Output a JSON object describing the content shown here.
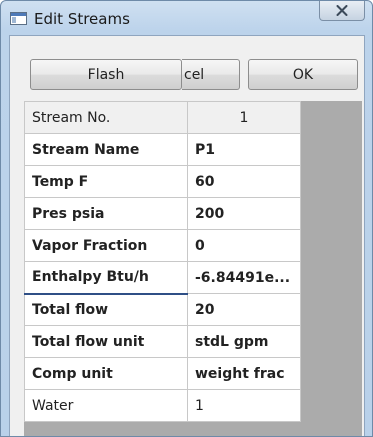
{
  "window": {
    "title": "Edit Streams"
  },
  "icons": {
    "app": "window-app-icon",
    "close": "close-icon"
  },
  "buttons": {
    "flash": "Flash",
    "cancel": "cel",
    "ok": "OK"
  },
  "grid": {
    "rows": [
      {
        "label": "Stream No.",
        "value": "1"
      },
      {
        "label": "Stream Name",
        "value": "P1"
      },
      {
        "label": "Temp  F",
        "value": "60"
      },
      {
        "label": "Pres  psia",
        "value": "200"
      },
      {
        "label": "Vapor Fraction",
        "value": "0"
      },
      {
        "label": "Enthalpy Btu/h",
        "value": "-6.84491e..."
      },
      {
        "label": "Total flow",
        "value": "20"
      },
      {
        "label": "Total flow unit",
        "value": "stdL gpm"
      },
      {
        "label": "Comp unit",
        "value": "weight frac"
      },
      {
        "label": "Water",
        "value": "1"
      }
    ]
  },
  "colors": {
    "input_value": "#cc1a1a",
    "selection_border": "#2f4f86"
  }
}
